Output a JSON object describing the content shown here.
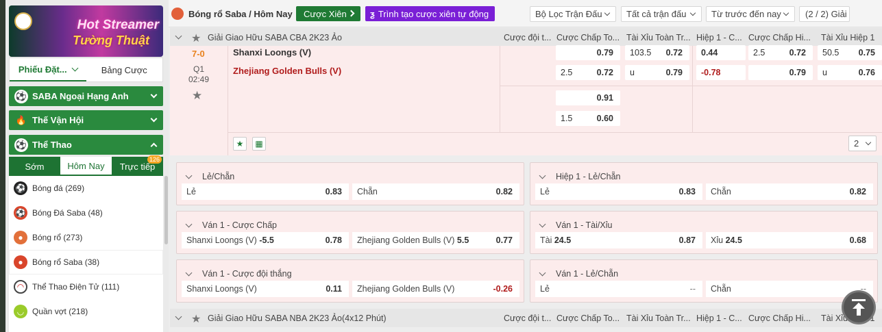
{
  "sidebar": {
    "banner": {
      "line1": "Hot Streamer",
      "line2": "Tường Thuật"
    },
    "bet_tabs": [
      {
        "label": "Phiếu Đặt..."
      },
      {
        "label": "Bảng Cược"
      }
    ],
    "groups": [
      {
        "label": "SABA Ngoại Hạng Anh",
        "icon": "saba-premier-icon"
      },
      {
        "label": "Thế Vận Hội",
        "icon": "torch-icon"
      },
      {
        "label": "Thể Thao",
        "icon": "sports-ball-icon"
      }
    ],
    "sport_tabs": [
      {
        "label": "Sớm"
      },
      {
        "label": "Hôm Nay"
      },
      {
        "label": "Trực tiếp",
        "badge": "126"
      }
    ],
    "sports": [
      {
        "label": "Bóng đá",
        "count": "(269)",
        "icon": "soccer-ball-icon"
      },
      {
        "label": "Bóng Đá Saba",
        "count": "(48)",
        "icon": "saba-soccer-icon"
      },
      {
        "label": "Bóng rổ",
        "count": "(273)",
        "icon": "basketball-icon"
      },
      {
        "label": "Bóng rổ Saba",
        "count": "(38)",
        "icon": "saba-basketball-icon"
      },
      {
        "label": "Thể Thao Điện Tử",
        "count": "(111)",
        "icon": "esports-headset-icon"
      },
      {
        "label": "Quần vợt",
        "count": "(218)",
        "icon": "tennis-ball-icon"
      }
    ]
  },
  "topbar": {
    "title": "Bóng rổ Saba / Hôm Nay",
    "parlay_button": "Cược Xiên",
    "parlay_builder_button": "Trình tạo cược xiên tự động",
    "filter_match": "Bộ Lọc Trận Đấu",
    "filter_all": "Tất cả trận đấu",
    "filter_time": "Từ trước đến nay",
    "league_count": "(2 / 2) Giải"
  },
  "columns": [
    "Cược đội t...",
    "Cược Chấp To...",
    "Tài Xỉu Toàn Tr...",
    "Hiệp 1 - C...",
    "Cược Chấp Hi...",
    "Tài Xỉu Hiệp 1"
  ],
  "league1": {
    "name": "Giải Giao Hữu SABA CBA 2K23 Ảo",
    "match": {
      "score": "7-0",
      "period": "Q1",
      "time": "02:49",
      "home": "Shanxi Loongs (V)",
      "away": "Zhejiang Golden Bulls (V)",
      "hdp_ft": [
        {
          "hc": "",
          "odd": "0.79"
        },
        {
          "hc": "2.5",
          "odd": "0.72"
        },
        {
          "hc": "",
          "odd": "0.91"
        },
        {
          "hc": "1.5",
          "odd": "0.60"
        }
      ],
      "ou_ft": [
        {
          "hc": "103.5",
          "odd": "0.72"
        },
        {
          "hc": "u",
          "odd": "0.79"
        }
      ],
      "ml_h1": [
        {
          "odd": "0.44"
        },
        {
          "odd": "-0.78"
        }
      ],
      "hdp_h1": [
        {
          "hc": "2.5",
          "odd": "0.72"
        },
        {
          "hc": "",
          "odd": "0.79"
        }
      ],
      "ou_h1": [
        {
          "hc": "50.5",
          "odd": "0.75"
        },
        {
          "hc": "u",
          "odd": "0.76"
        }
      ]
    },
    "pager_value": "2"
  },
  "markets": [
    {
      "title": "Lẻ/Chẵn",
      "o1": {
        "label": "Lẻ",
        "line": "",
        "odd": "0.83"
      },
      "o2": {
        "label": "Chẵn",
        "line": "",
        "odd": "0.82"
      }
    },
    {
      "title": "Hiệp 1 - Lẻ/Chẵn",
      "o1": {
        "label": "Lẻ",
        "line": "",
        "odd": "0.83"
      },
      "o2": {
        "label": "Chẵn",
        "line": "",
        "odd": "0.82"
      }
    },
    {
      "title": "Ván 1 - Cược Chấp",
      "o1": {
        "label": "Shanxi Loongs (V)",
        "line": "-5.5",
        "odd": "0.78"
      },
      "o2": {
        "label": "Zhejiang Golden Bulls (V)",
        "line": "5.5",
        "odd": "0.77"
      }
    },
    {
      "title": "Ván 1 - Tài/Xỉu",
      "o1": {
        "label": "Tài",
        "line": "24.5",
        "odd": "0.87"
      },
      "o2": {
        "label": "Xỉu",
        "line": "24.5",
        "odd": "0.68"
      }
    },
    {
      "title": "Ván 1 - Cược đội thắng",
      "o1": {
        "label": "Shanxi Loongs (V)",
        "line": "",
        "odd": "0.11"
      },
      "o2": {
        "label": "Zhejiang Golden Bulls (V)",
        "line": "",
        "odd": "-0.26"
      }
    },
    {
      "title": "Ván 1 - Lẻ/Chẵn",
      "o1": {
        "label": "Lẻ",
        "line": "",
        "odd": "--"
      },
      "o2": {
        "label": "Chẵn",
        "line": "",
        "odd": "--"
      }
    }
  ],
  "league2": {
    "name": "Giải Giao Hữu SABA NBA 2K23 Ảo(4x12 Phút)"
  },
  "colors": {
    "green": "#1f7a34",
    "purple": "#7a1fd6",
    "score_orange": "#e8821e",
    "negative_red": "#b01c1c",
    "row_pink": "#fcecec"
  }
}
